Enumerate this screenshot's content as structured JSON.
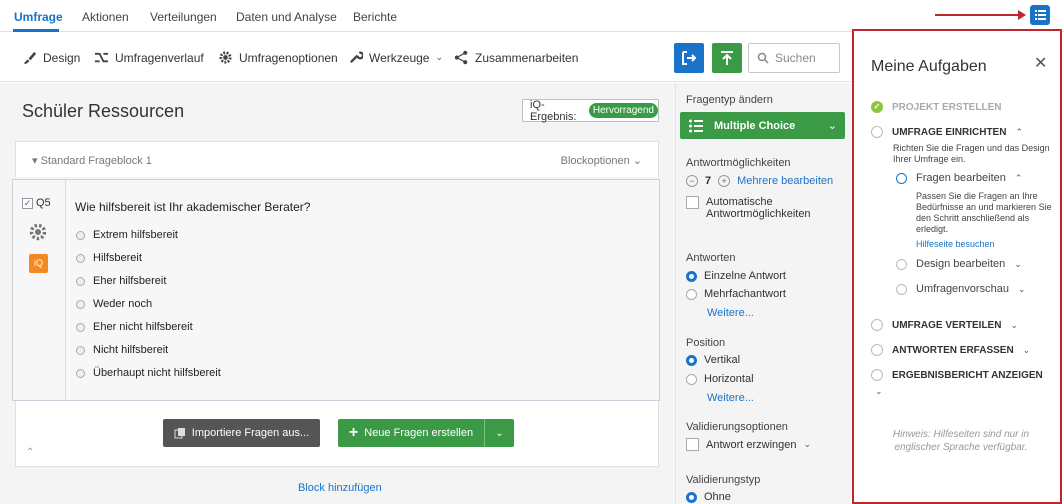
{
  "nav": {
    "tabs": [
      "Umfrage",
      "Aktionen",
      "Verteilungen",
      "Daten und Analyse",
      "Berichte"
    ],
    "active": "Umfrage"
  },
  "toolbar": {
    "design": "Design",
    "history": "Umfragenverlauf",
    "options": "Umfragenoptionen",
    "tools": "Werkzeuge",
    "collaborate": "Zusammenarbeiten",
    "search_placeholder": "Suchen"
  },
  "editor": {
    "title": "Schüler Ressourcen",
    "iq_label": "iQ-Ergebnis:",
    "iq_value": "Hervorragend",
    "block_title": "Standard Frageblock 1",
    "block_options": "Blockoptionen",
    "question": {
      "number": "Q5",
      "text": "Wie hilfsbereit ist Ihr akademischer Berater?",
      "choices": [
        "Extrem hilfsbereit",
        "Hilfsbereit",
        "Eher hilfsbereit",
        "Weder noch",
        "Eher nicht hilfsbereit",
        "Nicht hilfsbereit",
        "Überhaupt nicht hilfsbereit"
      ],
      "iq_icon": "iQ"
    },
    "import_button": "Importiere Fragen aus...",
    "new_button": "Neue Fragen erstellen",
    "add_block": "Block hinzufügen"
  },
  "props": {
    "qtype_label": "Fragentyp ändern",
    "qtype_value": "Multiple Choice",
    "choices_label": "Antwortmöglichkeiten",
    "choices_count": "7",
    "edit_more": "Mehrere bearbeiten",
    "auto_choices": "Automatische Antwortmöglichkeiten",
    "answers_label": "Antworten",
    "single": "Einzelne Antwort",
    "multi": "Mehrfachantwort",
    "more1": "Weitere...",
    "position_label": "Position",
    "vertical": "Vertikal",
    "horizontal": "Horizontal",
    "more2": "Weitere...",
    "validation_label": "Validierungsoptionen",
    "force": "Antwort erzwingen",
    "validation_type": "Validierungstyp",
    "none": "Ohne"
  },
  "aside": {
    "title": "Meine Aufgaben",
    "step1": "PROJEKT ERSTELLEN",
    "step2": "UMFRAGE EINRICHTEN",
    "step2_desc": "Richten Sie die Fragen und das Design Ihrer Umfrage ein.",
    "sub1": "Fragen bearbeiten",
    "sub1_desc": "Passen Sie die Fragen an Ihre Bedürfnisse an und markieren Sie den Schritt anschließend als erledigt.",
    "help_link": "Hilfeseite besuchen",
    "sub2": "Design bearbeiten",
    "sub3": "Umfragenvorschau",
    "step3": "UMFRAGE VERTEILEN",
    "step4": "ANTWORTEN ERFASSEN",
    "step5": "ERGEBNISBERICHT ANZEIGEN",
    "hint": "Hinweis: Hilfeseiten sind nur in englischer Sprache verfügbar."
  },
  "colors": {
    "accent": "#1a73c8",
    "green": "#3a9a46",
    "highlight": "#c0262d"
  }
}
